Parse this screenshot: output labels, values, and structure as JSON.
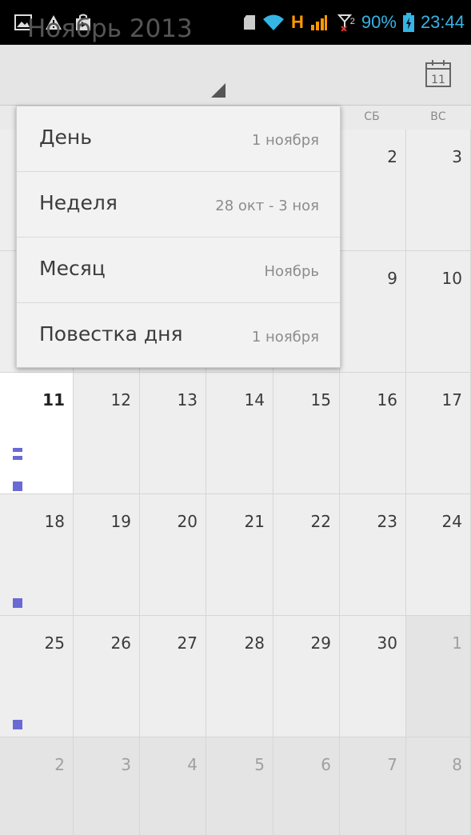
{
  "status_bar": {
    "network_label": "H",
    "sim2_label": "2",
    "battery_percent": "90%",
    "time": "23:44",
    "accent_color": "#34b5e5"
  },
  "action_bar": {
    "title": "Ноябрь 2013",
    "today_icon_day": "11"
  },
  "weekdays": {
    "sat": "СБ",
    "sun": "ВС"
  },
  "menu": {
    "items": [
      {
        "label": "День",
        "sub": "1 ноября",
        "icon": ""
      },
      {
        "label": "Неделя",
        "sub": "28 окт - 3 ноя",
        "icon": ""
      },
      {
        "label": "Месяц",
        "sub": "Ноябрь",
        "icon": ""
      },
      {
        "label": "Повестка дня",
        "sub": "1 ноября",
        "icon": ""
      }
    ]
  },
  "calendar": {
    "event_color": "#6a6ad4",
    "rows": [
      [
        "",
        "",
        "",
        "",
        "",
        "2",
        "3"
      ],
      [
        "",
        "",
        "",
        "",
        "",
        "9",
        "10"
      ],
      [
        "11",
        "12",
        "13",
        "14",
        "15",
        "16",
        "17"
      ],
      [
        "18",
        "19",
        "20",
        "21",
        "22",
        "23",
        "24"
      ],
      [
        "25",
        "26",
        "27",
        "28",
        "29",
        "30",
        "1"
      ],
      [
        "2",
        "3",
        "4",
        "5",
        "6",
        "7",
        "8"
      ]
    ]
  }
}
